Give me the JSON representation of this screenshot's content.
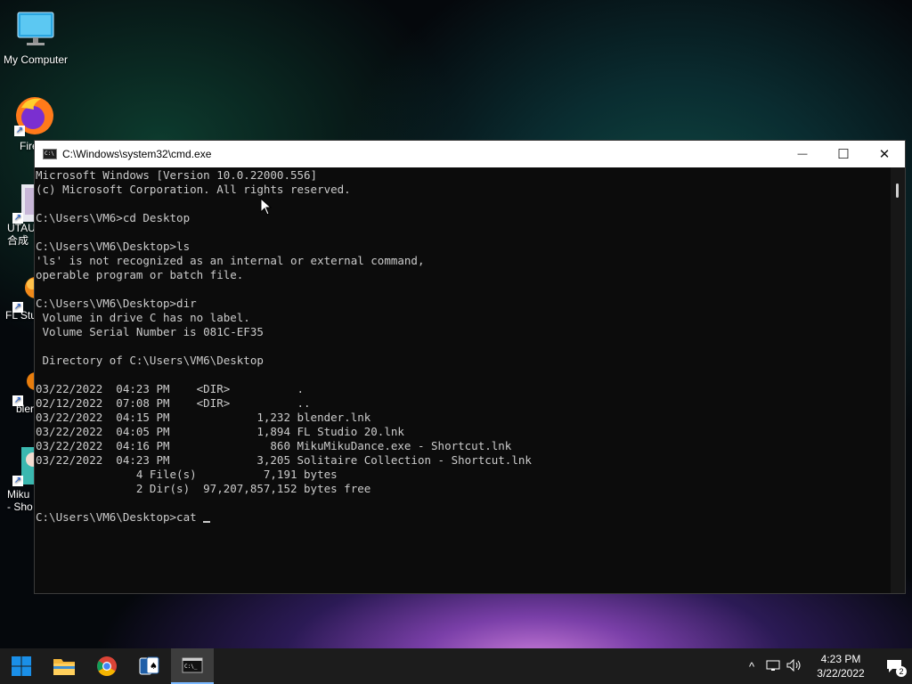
{
  "desktop": {
    "icons": [
      {
        "label": "My Computer",
        "icon": "monitor-icon"
      },
      {
        "label": "Fire",
        "icon": "firefox-icon"
      },
      {
        "label": "UTAU\n合成",
        "icon": "utau-icon"
      },
      {
        "label": "FL Stu",
        "icon": "fl-studio-icon"
      },
      {
        "label": "bler",
        "icon": "blender-icon"
      },
      {
        "label": "Miku\n- Sho",
        "icon": "mikumikudance-icon"
      }
    ]
  },
  "window": {
    "title": "C:\\Windows\\system32\\cmd.exe",
    "buttons": {
      "minimize": "—",
      "maximize": "☐",
      "close": "✕"
    },
    "lines": [
      "Microsoft Windows [Version 10.0.22000.556]",
      "(c) Microsoft Corporation. All rights reserved.",
      "",
      "C:\\Users\\VM6>cd Desktop",
      "",
      "C:\\Users\\VM6\\Desktop>ls",
      "'ls' is not recognized as an internal or external command,",
      "operable program or batch file.",
      "",
      "C:\\Users\\VM6\\Desktop>dir",
      " Volume in drive C has no label.",
      " Volume Serial Number is 081C-EF35",
      "",
      " Directory of C:\\Users\\VM6\\Desktop",
      "",
      "03/22/2022  04:23 PM    <DIR>          .",
      "02/12/2022  07:08 PM    <DIR>          ..",
      "03/22/2022  04:15 PM             1,232 blender.lnk",
      "03/22/2022  04:05 PM             1,894 FL Studio 20.lnk",
      "03/22/2022  04:16 PM               860 MikuMikuDance.exe - Shortcut.lnk",
      "03/22/2022  04:23 PM             3,205 Solitaire Collection - Shortcut.lnk",
      "               4 File(s)          7,191 bytes",
      "               2 Dir(s)  97,207,857,152 bytes free",
      ""
    ],
    "prompt": "C:\\Users\\VM6\\Desktop>cat "
  },
  "taskbar": {
    "apps": [
      {
        "name": "start-button",
        "icon": "windows-logo-icon"
      },
      {
        "name": "file-explorer",
        "icon": "folder-icon"
      },
      {
        "name": "chrome",
        "icon": "chrome-icon"
      },
      {
        "name": "solitaire",
        "icon": "cards-icon"
      },
      {
        "name": "command-prompt",
        "icon": "terminal-icon"
      }
    ],
    "tray": {
      "chevron": "^",
      "time": "4:23 PM",
      "date": "3/22/2022",
      "notification_count": "2"
    }
  }
}
